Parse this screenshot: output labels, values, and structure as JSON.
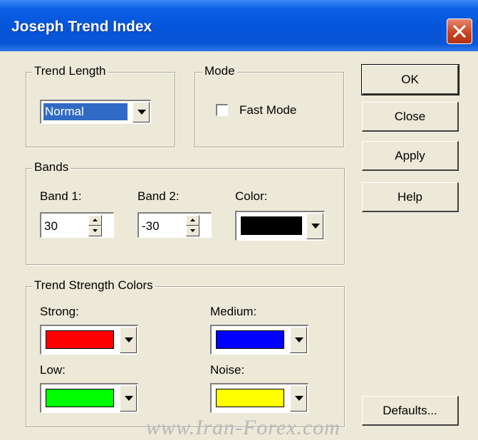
{
  "window": {
    "title": "Joseph Trend Index"
  },
  "trend_length": {
    "legend": "Trend Length",
    "selected": "Normal"
  },
  "mode": {
    "legend": "Mode",
    "fast_mode_label": "Fast Mode",
    "fast_mode_checked": false
  },
  "bands": {
    "legend": "Bands",
    "band1_label": "Band 1:",
    "band1_value": "30",
    "band2_label": "Band 2:",
    "band2_value": "-30",
    "color_label": "Color:",
    "color_value": "#000000"
  },
  "strength_colors": {
    "legend": "Trend Strength Colors",
    "strong_label": "Strong:",
    "strong_color": "#ff0000",
    "medium_label": "Medium:",
    "medium_color": "#0000ff",
    "low_label": "Low:",
    "low_color": "#00ff00",
    "noise_label": "Noise:",
    "noise_color": "#ffff00"
  },
  "buttons": {
    "ok": "OK",
    "close": "Close",
    "apply": "Apply",
    "help": "Help",
    "defaults": "Defaults..."
  },
  "watermark": "www.Iran-Forex.com",
  "icons": {
    "close": "close-icon",
    "dropdown": "chevron-down-icon",
    "spin_up": "spin-up-icon",
    "spin_down": "spin-down-icon"
  }
}
